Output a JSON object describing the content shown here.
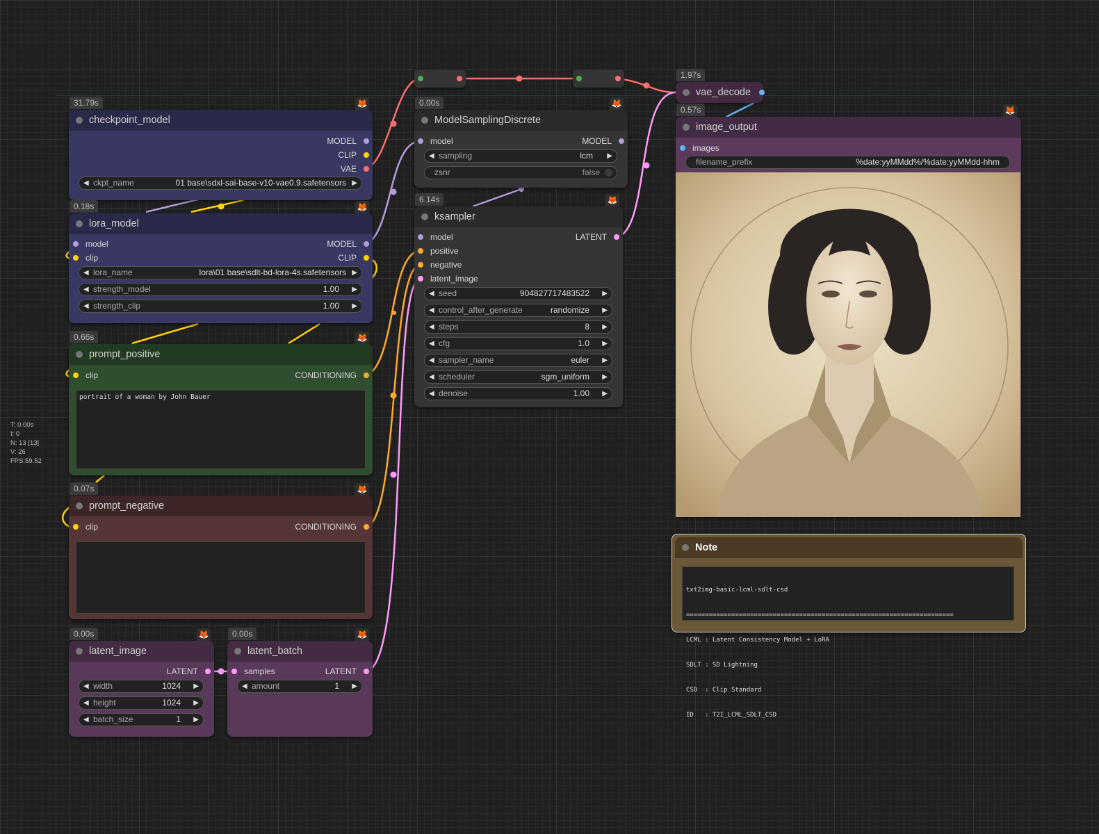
{
  "stats": [
    "T: 0.00s",
    "I: 0",
    "N: 13 [13]",
    "V: 26",
    "FPS:59.52"
  ],
  "colors": {
    "model": "#b39ddb",
    "clip": "#ffd500",
    "vae": "#ff6e6e",
    "conditioning": "#ffa931",
    "latent": "#ff9cf9",
    "image": "#64b5f6",
    "fox_badge": "#ff8a2a"
  },
  "fox_icon": "🦊",
  "nodes": {
    "checkpoint_model": {
      "time": "31.79s",
      "title": "checkpoint_model",
      "outputs": [
        "MODEL",
        "CLIP",
        "VAE"
      ],
      "ckpt_name_label": "ckpt_name",
      "ckpt_name_value": "01 base\\sdxl-sai-base-v10-vae0.9.safetensors"
    },
    "lora_model": {
      "time": "0.18s",
      "title": "lora_model",
      "inputs": [
        "model",
        "clip"
      ],
      "outputs": [
        "MODEL",
        "CLIP"
      ],
      "widgets": [
        {
          "label": "lora_name",
          "value": "lora\\01 base\\sdlt-bd-lora-4s.safetensors"
        },
        {
          "label": "strength_model",
          "value": "1.00"
        },
        {
          "label": "strength_clip",
          "value": "1.00"
        }
      ]
    },
    "prompt_positive": {
      "time": "0.66s",
      "title": "prompt_positive",
      "input": "clip",
      "output": "CONDITIONING",
      "text": "portrait of a woman by John Bauer"
    },
    "prompt_negative": {
      "time": "0.07s",
      "title": "prompt_negative",
      "input": "clip",
      "output": "CONDITIONING",
      "text": ""
    },
    "latent_image": {
      "time": "0.00s",
      "title": "latent_image",
      "output": "LATENT",
      "widgets": [
        {
          "label": "width",
          "value": "1024"
        },
        {
          "label": "height",
          "value": "1024"
        },
        {
          "label": "batch_size",
          "value": "1"
        }
      ]
    },
    "latent_batch": {
      "time": "0.00s",
      "title": "latent_batch",
      "input": "samples",
      "output": "LATENT",
      "widgets": [
        {
          "label": "amount",
          "value": "1"
        }
      ]
    },
    "model_sampling": {
      "time": "0.00s",
      "title": "ModelSamplingDiscrete",
      "input": "model",
      "output": "MODEL",
      "sampling_label": "sampling",
      "sampling_value": "lcm",
      "zsnr_label": "zsnr",
      "zsnr_value": "false"
    },
    "ksampler": {
      "time": "6.14s",
      "title": "ksampler",
      "inputs": [
        "model",
        "positive",
        "negative",
        "latent_image"
      ],
      "output": "LATENT",
      "widgets": [
        {
          "label": "seed",
          "value": "904827717483522"
        },
        {
          "label": "control_after_generate",
          "value": "randomize"
        },
        {
          "label": "steps",
          "value": "8"
        },
        {
          "label": "cfg",
          "value": "1.0"
        },
        {
          "label": "sampler_name",
          "value": "euler"
        },
        {
          "label": "scheduler",
          "value": "sgm_uniform"
        },
        {
          "label": "denoise",
          "value": "1.00"
        }
      ]
    },
    "vae_decode": {
      "time": "1.97s",
      "title": "vae_decode"
    },
    "image_output": {
      "time": "0.57s",
      "title": "image_output",
      "input": "images",
      "filename_prefix_label": "filename_prefix",
      "filename_prefix_value": "%date:yyMMdd%/%date:yyMMdd-hhm"
    },
    "note": {
      "title": "Note",
      "lines": [
        "txt2img-basic-lcml-sdlt-csd",
        "=======================================================================",
        "LCML : Latent Consistency Model + LoRA",
        "SDLT : SD Lightning",
        "CSD  : Clip Standard",
        "ID   : T2I_LCML_SDLT_CSD"
      ]
    }
  }
}
